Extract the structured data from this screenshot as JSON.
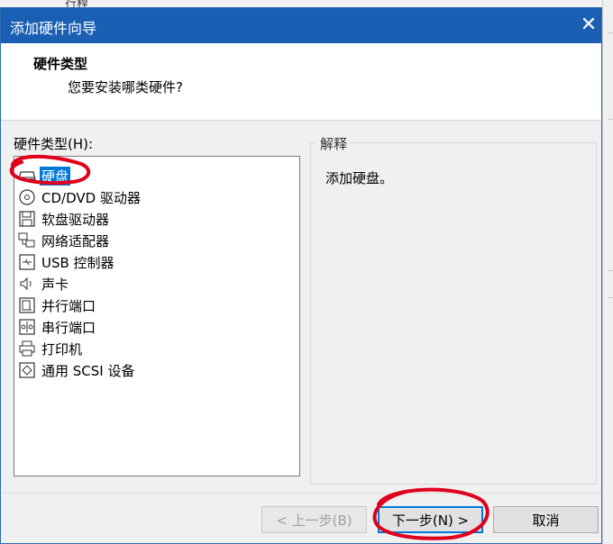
{
  "background": {
    "partial_text": "行程"
  },
  "dialog": {
    "title": "添加硬件向导",
    "close_glyph": "✕",
    "header": {
      "title": "硬件类型",
      "subtitle": "您要安装哪类硬件?"
    },
    "hardware_list": {
      "label": "硬件类型(H):",
      "selected_index": 0,
      "items": [
        {
          "label": "硬盘",
          "icon": "hard-disk-icon"
        },
        {
          "label": "CD/DVD 驱动器",
          "icon": "cd-dvd-icon"
        },
        {
          "label": "软盘驱动器",
          "icon": "floppy-icon"
        },
        {
          "label": "网络适配器",
          "icon": "network-adapter-icon"
        },
        {
          "label": "USB 控制器",
          "icon": "usb-icon"
        },
        {
          "label": "声卡",
          "icon": "speaker-icon"
        },
        {
          "label": "并行端口",
          "icon": "parallel-port-icon"
        },
        {
          "label": "串行端口",
          "icon": "serial-port-icon"
        },
        {
          "label": "打印机",
          "icon": "printer-icon"
        },
        {
          "label": "通用 SCSI 设备",
          "icon": "scsi-icon"
        }
      ]
    },
    "explanation": {
      "legend": "解释",
      "text": "添加硬盘。"
    },
    "buttons": {
      "back": "< 上一步(B)",
      "next": "下一步(N) >",
      "cancel": "取消"
    }
  },
  "colors": {
    "title_bar": "#1a5fb4",
    "selection": "#0078d7",
    "annotation": "#e0001b"
  }
}
